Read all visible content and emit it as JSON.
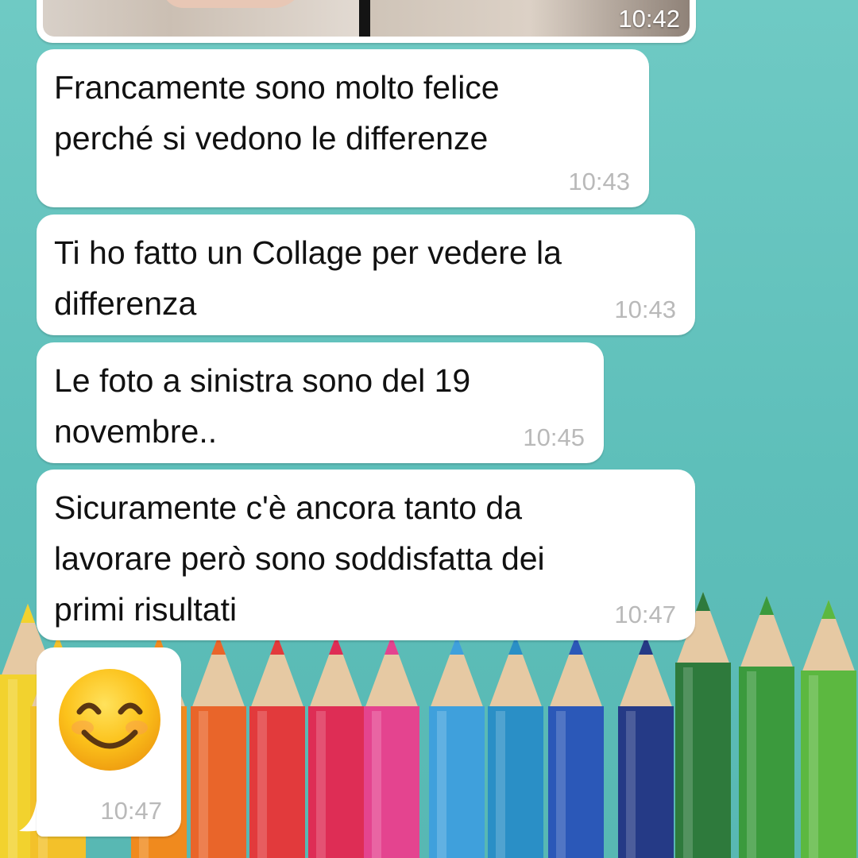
{
  "chat": {
    "photo": {
      "time": "10:42"
    },
    "messages": [
      {
        "text": "Francamente sono molto felice\nperché si vedono le differenze",
        "time": "10:43"
      },
      {
        "text": "Ti ho fatto un Collage per vedere la\ndifferenza",
        "time": "10:43"
      },
      {
        "text": "Le foto a sinistra sono del 19\nnovembre..",
        "time": "10:45"
      },
      {
        "text": "Sicuramente c'è ancora tanto da\nlavorare però sono soddisfatta dei\nprimi risultati",
        "time": "10:47"
      }
    ],
    "emoji_message": {
      "emoji": "smiling-face-with-smiling-eyes",
      "time": "10:47"
    }
  },
  "wallpaper": {
    "background": "#5ebfba",
    "pencil_colors": [
      "#f2d22e",
      "#f3c12a",
      "#f08a1e",
      "#e9652a",
      "#e23a3c",
      "#de2d55",
      "#e4448f",
      "#3fa0dc",
      "#2a8fc6",
      "#2b58b8",
      "#253a86",
      "#2e7a3c",
      "#3b9a3d",
      "#5cb840"
    ]
  }
}
